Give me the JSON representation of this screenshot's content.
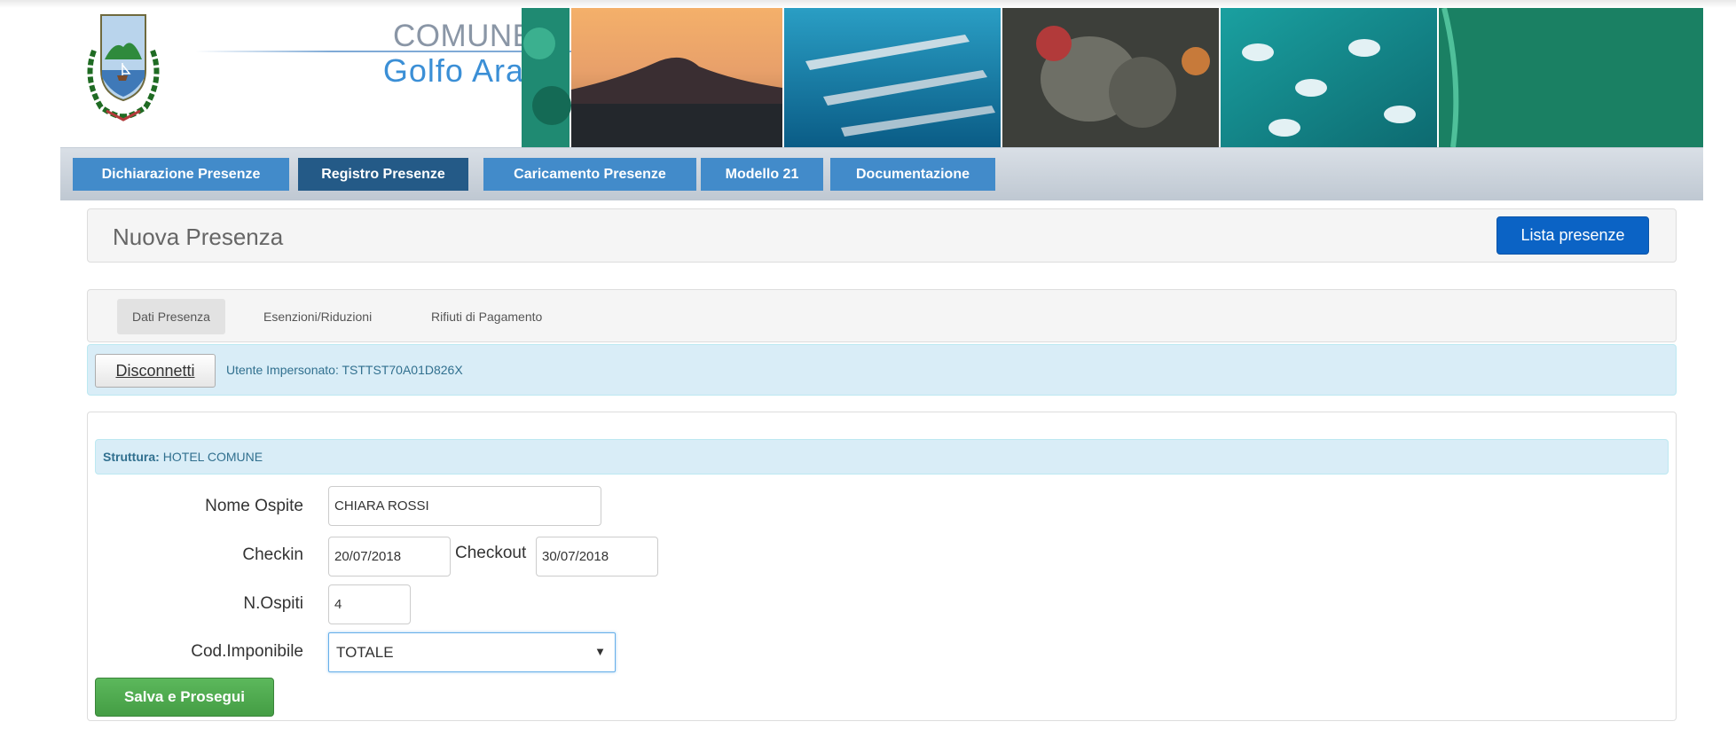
{
  "header": {
    "title_line1": "COMUNE di",
    "title_line2": "Golfo Aranci"
  },
  "nav": {
    "tabs": [
      {
        "label": "Dichiarazione Presenze",
        "active": false
      },
      {
        "label": "Registro Presenze",
        "active": true
      },
      {
        "label": "Caricamento Presenze",
        "active": false
      },
      {
        "label": "Modello 21",
        "active": false
      },
      {
        "label": "Documentazione",
        "active": false
      }
    ]
  },
  "page": {
    "title": "Nuova Presenza",
    "lista_button": "Lista presenze"
  },
  "subtabs": [
    {
      "label": "Dati Presenza",
      "active": true
    },
    {
      "label": "Esenzioni/Riduzioni",
      "active": false
    },
    {
      "label": "Rifiuti di Pagamento",
      "active": false
    }
  ],
  "impersonation": {
    "disconnect_label": "Disconnetti",
    "text": "Utente Impersonato: TSTTST70A01D826X"
  },
  "form": {
    "struttura_label": "Struttura:",
    "struttura_value": "HOTEL COMUNE",
    "nome_label": "Nome Ospite",
    "nome_value": "CHIARA ROSSI",
    "checkin_label": "Checkin",
    "checkin_value": "20/07/2018",
    "checkout_label": "Checkout",
    "checkout_value": "30/07/2018",
    "ospiti_label": "N.Ospiti",
    "ospiti_value": "4",
    "imponibile_label": "Cod.Imponibile",
    "imponibile_selected": "TOTALE",
    "dropdown_icon": "triangle-down",
    "save_label": "Salva e Prosegui"
  },
  "colors": {
    "nav_tab": "#428bca",
    "nav_tab_active": "#245a87",
    "primary_button": "#0b63c5",
    "info_background": "#d9edf7",
    "info_text": "#31708f",
    "success_button": "#5cb85c"
  }
}
